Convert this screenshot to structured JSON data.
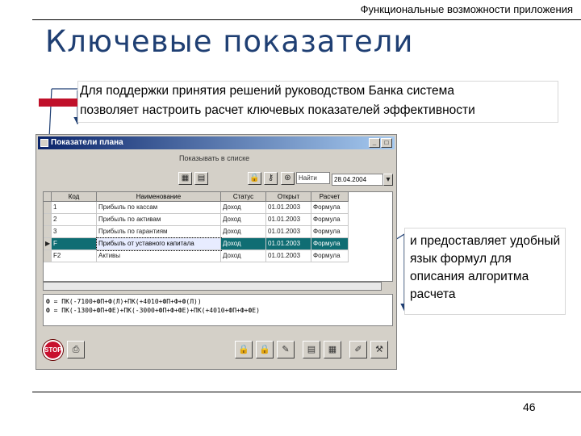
{
  "slide": {
    "header": "Функциональные возможности приложения",
    "title": "Ключевые показатели",
    "callout_top_line1": "Для поддержки принятия решений руководством Банка система",
    "callout_top_line2": "позволяет настроить расчет ключевых показателей эффективности",
    "callout_right": "и предоставляет удобный язык формул для описания алгоритма расчета",
    "page_number": "46"
  },
  "colors": {
    "title": "#1f3f73",
    "accent_red": "#c0102a",
    "selection": "#0f6d73"
  },
  "app": {
    "window_title": "Показатели плана",
    "show_in_list": "Показывать в списке",
    "search_label": "Найти",
    "date": "28.04.2004",
    "columns": [
      "Код",
      "Наименование",
      "Статус",
      "Открыт",
      "Расчет"
    ],
    "rows": [
      [
        "1",
        "Прибыль по кассам",
        "Доход",
        "01.01.2003",
        "Формула"
      ],
      [
        "2",
        "Прибыль по активам",
        "Доход",
        "01.01.2003",
        "Формула"
      ],
      [
        "3",
        "Прибыль по гарантиям",
        "Доход",
        "01.01.2003",
        "Формула"
      ],
      [
        "F",
        "Прибыль от уставного капитала",
        "Доход",
        "01.01.2003",
        "Формула"
      ],
      [
        "F2",
        "Активы",
        "Доход",
        "01.01.2003",
        "Формула"
      ]
    ],
    "formula_line1": "Ф = ПК(-7100+ФП+Ф(Л)+ПК(+4010+ФП+Ф+Ф(Л))",
    "formula_line2": "Ф = ПК(-1300+ФП+ФЕ)+ПК(-3000+ФП+Ф+ФЕ)+ПК(+4010+ФП+Ф+ФЕ)",
    "window_buttons": {
      "minimize": "_",
      "maximize": "□",
      "close": "×"
    },
    "stop_label": "STOP",
    "icons": [
      "calculator-icon",
      "table-icon",
      "lock-icon",
      "key-icon",
      "binoculars-icon",
      "calendar-icon",
      "stop-icon",
      "print-icon",
      "lock-icon",
      "lock-icon",
      "feather-icon",
      "document-icon",
      "document-icon",
      "ruler-icon",
      "tools-icon"
    ]
  }
}
